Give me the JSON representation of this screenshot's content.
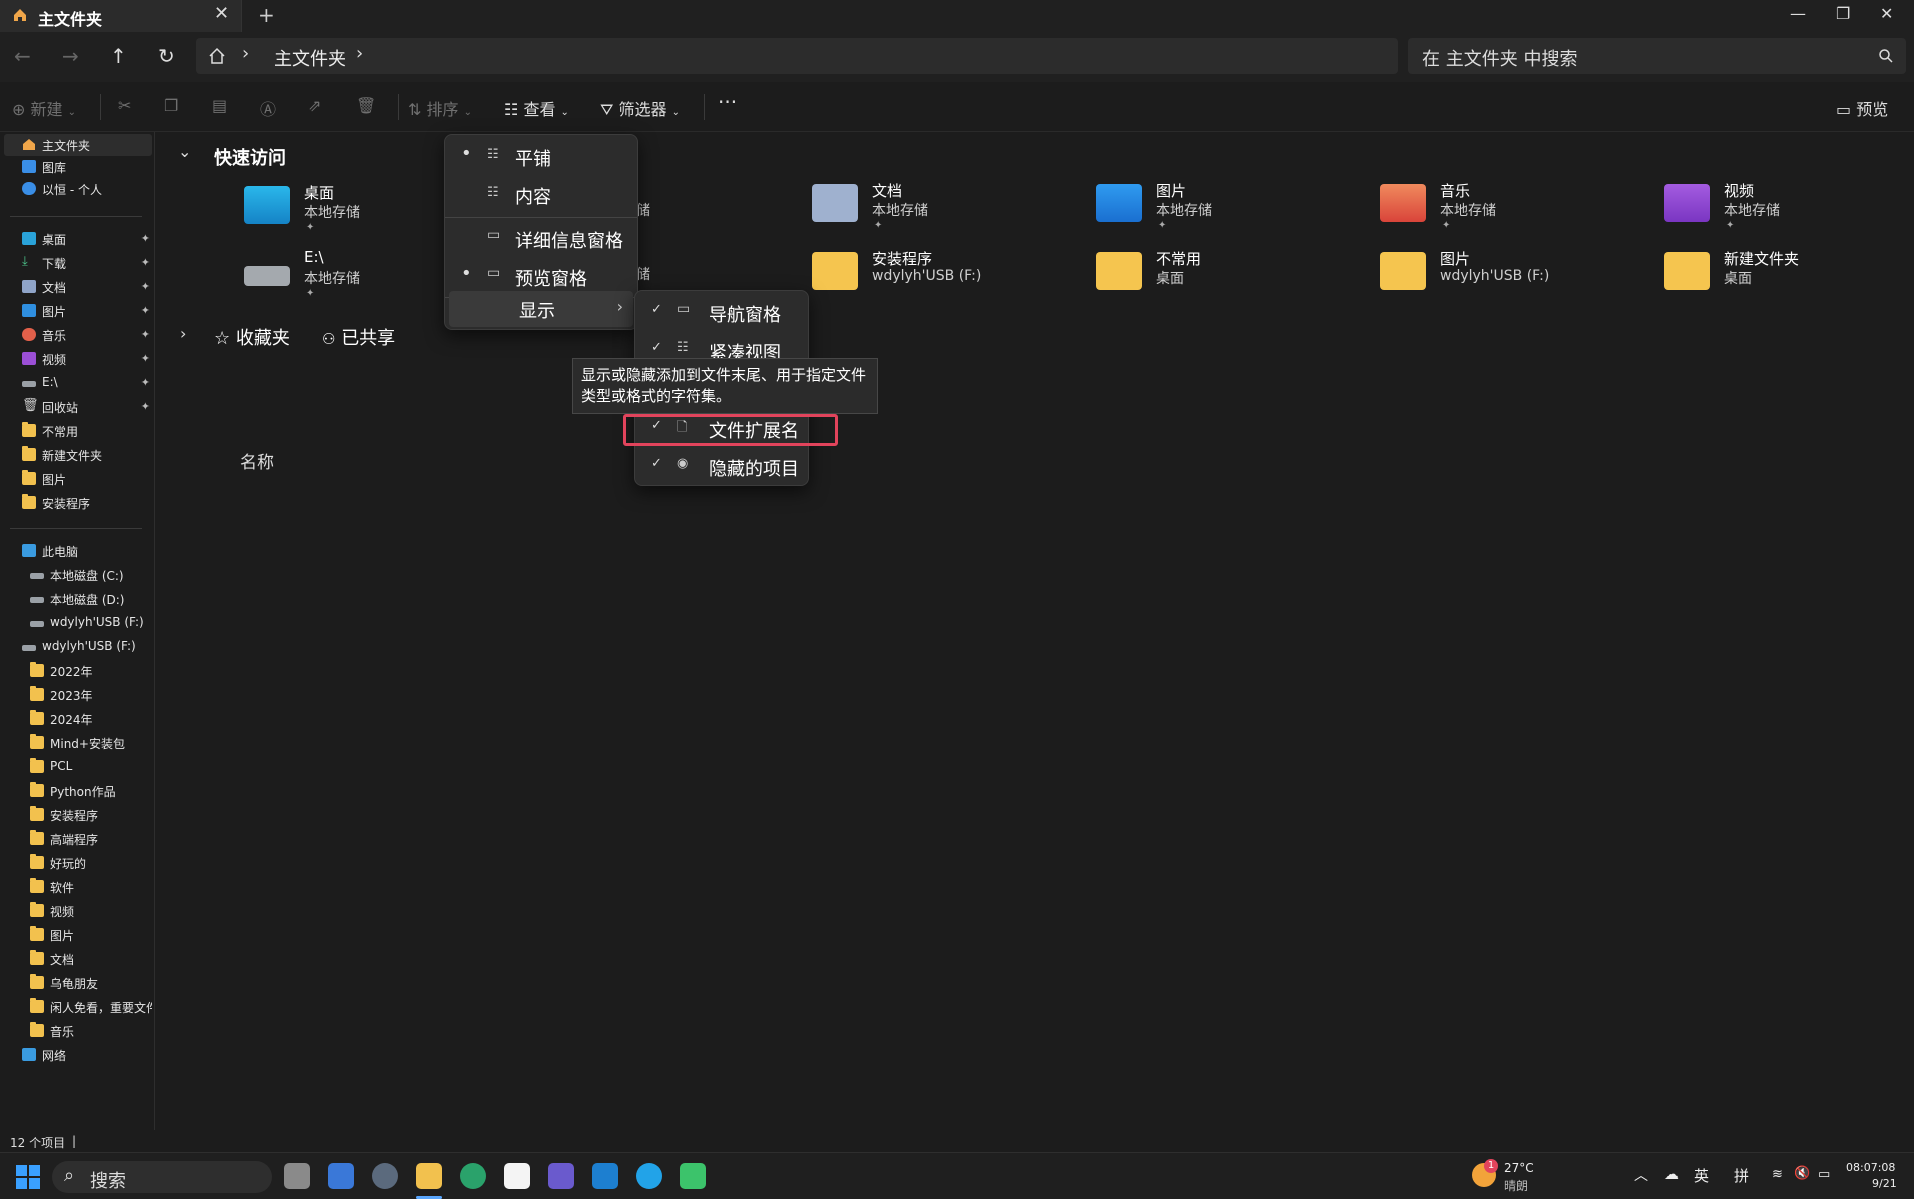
{
  "window": {
    "tab_title": "主文件夹",
    "tab_close": "✕",
    "new_tab": "+",
    "min": "—",
    "restore": "❐",
    "close": "✕"
  },
  "nav": {
    "back": "←",
    "forward": "→",
    "up": "↑",
    "refresh": "↻",
    "chevron": "›",
    "crumb": "主文件夹",
    "search_placeholder": "在 主文件夹 中搜索"
  },
  "toolbar": {
    "new": "新建",
    "sort": "排序",
    "view": "查看",
    "filter": "筛选器",
    "more": "···",
    "preview": "预览"
  },
  "sidebar": {
    "top": [
      {
        "label": "主文件夹"
      },
      {
        "label": "图库"
      },
      {
        "label": "以恒 - 个人"
      }
    ],
    "pinned": [
      {
        "label": "桌面"
      },
      {
        "label": "下载"
      },
      {
        "label": "文档"
      },
      {
        "label": "图片"
      },
      {
        "label": "音乐"
      },
      {
        "label": "视频"
      },
      {
        "label": "E:\\"
      },
      {
        "label": "回收站"
      },
      {
        "label": "不常用"
      },
      {
        "label": "新建文件夹"
      },
      {
        "label": "图片"
      },
      {
        "label": "安装程序"
      }
    ],
    "pc": {
      "label": "此电脑"
    },
    "drives": [
      {
        "label": "本地磁盘 (C:)"
      },
      {
        "label": "本地磁盘 (D:)"
      },
      {
        "label": "wdylyh'USB (F:)"
      }
    ],
    "usb": {
      "label": "wdylyh'USB (F:)"
    },
    "usb_folders": [
      {
        "label": "2022年"
      },
      {
        "label": "2023年"
      },
      {
        "label": "2024年"
      },
      {
        "label": "Mind+安装包"
      },
      {
        "label": "PCL"
      },
      {
        "label": "Python作品"
      },
      {
        "label": "安装程序"
      },
      {
        "label": "高端程序"
      },
      {
        "label": "好玩的"
      },
      {
        "label": "软件"
      },
      {
        "label": "视频"
      },
      {
        "label": "图片"
      },
      {
        "label": "文档"
      },
      {
        "label": "乌龟朋友"
      },
      {
        "label": "闲人免看，重要文件"
      },
      {
        "label": "音乐"
      }
    ],
    "network": {
      "label": "网络"
    },
    "pin_glyph": "📌"
  },
  "main": {
    "quick_access": "快速访问",
    "favorites": "收藏夹",
    "shared": "已共享",
    "name_header": "名称",
    "partial_label": "储",
    "items": [
      {
        "name": "桌面",
        "sub": "本地存储",
        "pinned": true
      },
      {
        "name": "文档",
        "sub": "本地存储",
        "pinned": true
      },
      {
        "name": "图片",
        "sub": "本地存储",
        "pinned": true
      },
      {
        "name": "音乐",
        "sub": "本地存储",
        "pinned": true
      },
      {
        "name": "视频",
        "sub": "本地存储",
        "pinned": true
      },
      {
        "name": "E:\\",
        "sub": "本地存储",
        "pinned": true
      },
      {
        "name": "安装程序",
        "sub": "wdylyh'USB (F:)"
      },
      {
        "name": "不常用",
        "sub": "桌面"
      },
      {
        "name": "图片",
        "sub": "wdylyh'USB (F:)"
      },
      {
        "name": "新建文件夹",
        "sub": "桌面"
      }
    ]
  },
  "view_menu": {
    "tiles": "平铺",
    "content": "内容",
    "details_pane": "详细信息窗格",
    "preview_pane": "预览窗格",
    "show": "显示"
  },
  "show_menu": {
    "nav_pane": "导航窗格",
    "compact": "紧凑视图",
    "extensions": "文件扩展名",
    "hidden": "隐藏的项目",
    "check": "✓"
  },
  "tooltip": "显示或隐藏添加到文件末尾、用于指定文件类型或格式的字符集。",
  "status": {
    "count": "12 个项目",
    "sep": "|"
  },
  "taskbar": {
    "search": "搜索",
    "weather_temp": "27°C",
    "weather_desc": "晴朗",
    "badge": "1",
    "ime_lang": "英",
    "ime_mode": "拼",
    "time": "08:07:08",
    "date": "9/21"
  },
  "colors": {
    "accent_highlight": "#e2445c",
    "folder": "#f2c14e"
  }
}
